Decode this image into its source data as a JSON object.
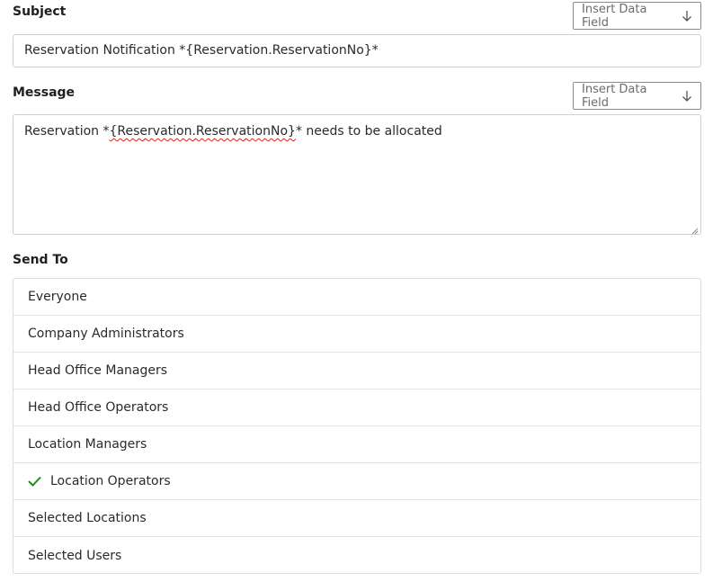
{
  "subject": {
    "label": "Subject",
    "insert_button": "Insert Data Field",
    "value": "Reservation Notification *{Reservation.ReservationNo}*"
  },
  "message": {
    "label": "Message",
    "insert_button": "Insert Data Field",
    "value_prefix": "Reservation *",
    "value_field": "{Reservation.ReservationNo}",
    "value_suffix": "* needs to be allocated"
  },
  "send_to": {
    "label": "Send To",
    "items": [
      {
        "label": "Everyone",
        "checked": false
      },
      {
        "label": "Company Administrators",
        "checked": false
      },
      {
        "label": "Head Office Managers",
        "checked": false
      },
      {
        "label": "Head Office Operators",
        "checked": false
      },
      {
        "label": "Location Managers",
        "checked": false
      },
      {
        "label": "Location Operators",
        "checked": true
      },
      {
        "label": "Selected Locations",
        "checked": false
      },
      {
        "label": "Selected Users",
        "checked": false
      }
    ]
  },
  "icons": {
    "insert": "arrow-down-icon",
    "check": "checkmark-icon",
    "resize": "resize-grip-icon"
  },
  "colors": {
    "check": "#1e8a1e",
    "spellcheck": "#e02020"
  }
}
